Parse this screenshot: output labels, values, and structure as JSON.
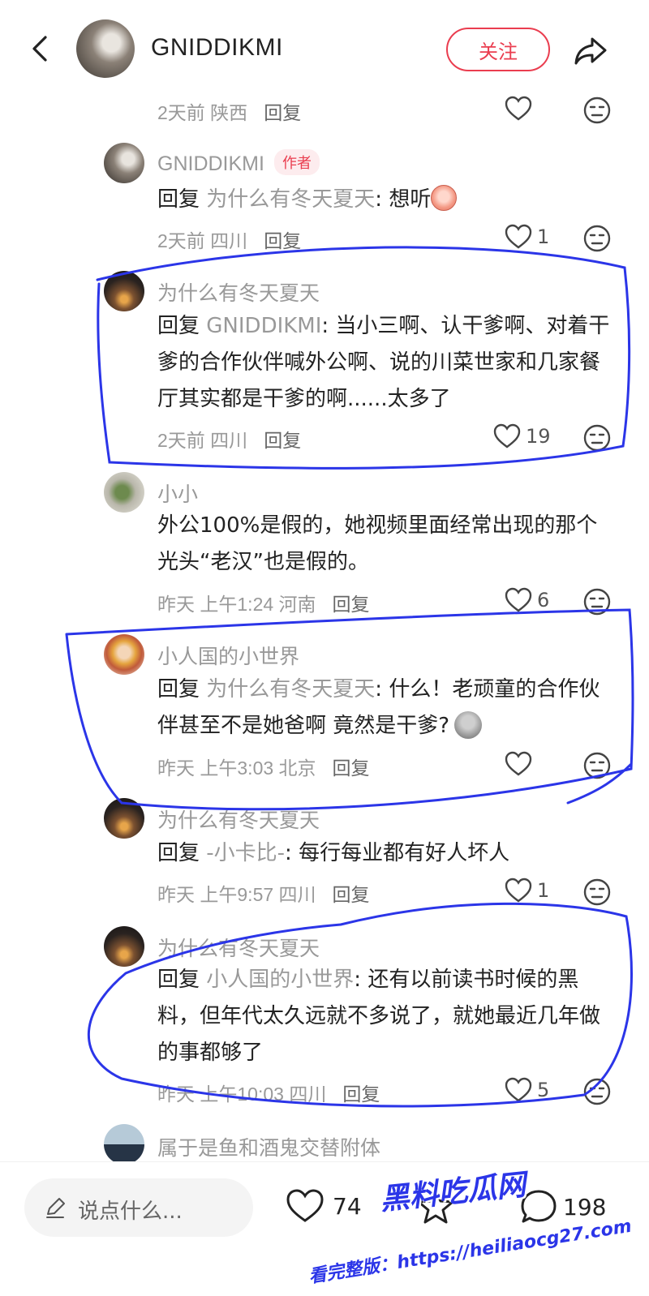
{
  "header": {
    "username": "GNIDDIKMI",
    "follow_label": "关注"
  },
  "comments": [
    {
      "meta": "2天前 陕西",
      "reply_label": "回复",
      "likes": ""
    },
    {
      "username": "GNIDDIKMI",
      "badge": "作者",
      "reply_prefix": "回复",
      "reply_to": "为什么有冬天夏天",
      "text": ": 想听",
      "meta": "2天前 四川",
      "reply_label": "回复",
      "likes": "1"
    },
    {
      "username": "为什么有冬天夏天",
      "reply_prefix": "回复",
      "reply_to": "GNIDDIKMI",
      "text": ": 当小三啊、认干爹啊、对着干爹的合作伙伴喊外公啊、说的川菜世家和几家餐厅其实都是干爹的啊......太多了",
      "meta": "2天前 四川",
      "reply_label": "回复",
      "likes": "19"
    },
    {
      "username": "小小",
      "text": "外公100%是假的，她视频里面经常出现的那个光头“老汉”也是假的。",
      "meta": "昨天 上午1:24 河南",
      "reply_label": "回复",
      "likes": "6"
    },
    {
      "username": "小人国的小世界",
      "reply_prefix": "回复",
      "reply_to": "为什么有冬天夏天",
      "text": ": 什么！老顽童的合作伙伴甚至不是她爸啊 竟然是干爹?",
      "meta": "昨天 上午3:03 北京",
      "reply_label": "回复",
      "likes": ""
    },
    {
      "username": "为什么有冬天夏天",
      "reply_prefix": "回复",
      "reply_to": "-小卡比-",
      "text": ": 每行每业都有好人坏人",
      "meta": "昨天 上午9:57 四川",
      "reply_label": "回复",
      "likes": "1"
    },
    {
      "username": "为什么有冬天夏天",
      "reply_prefix": "回复",
      "reply_to": "小人国的小世界",
      "text": ": 还有以前读书时候的黑料，但年代太久远就不多说了，就她最近几年做的事都够了",
      "meta": "昨天 上午10:03 四川",
      "reply_label": "回复",
      "likes": "5"
    },
    {
      "username": "属于是鱼和酒鬼交替附体"
    }
  ],
  "bottom_bar": {
    "input_placeholder": "说点什么...",
    "like_count": "74",
    "comment_count": "198"
  },
  "watermark": {
    "title": "黑料吃瓜网",
    "subtitle": "看完整版：https://heiliaocg27.com"
  },
  "colors": {
    "accent": "#ea3d4f",
    "annotation": "#2b35e8"
  }
}
